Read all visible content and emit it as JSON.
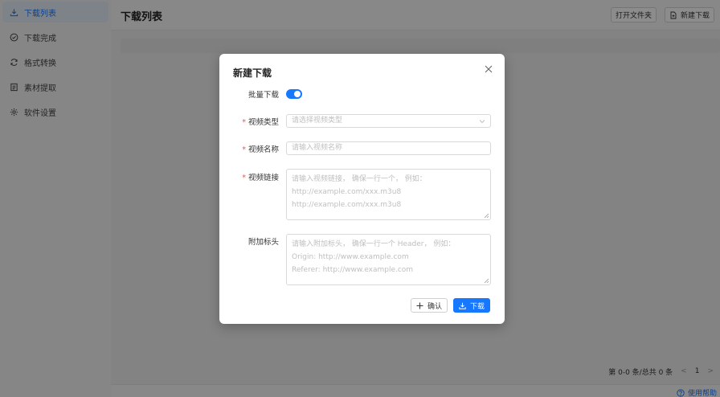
{
  "sidebar": {
    "items": [
      {
        "label": "下载列表",
        "icon": "download-icon",
        "active": true
      },
      {
        "label": "下载完成",
        "icon": "check-circle-icon",
        "active": false
      },
      {
        "label": "格式转换",
        "icon": "refresh-icon",
        "active": false
      },
      {
        "label": "素材提取",
        "icon": "document-icon",
        "active": false
      },
      {
        "label": "软件设置",
        "icon": "gear-icon",
        "active": false
      }
    ]
  },
  "header": {
    "title": "下载列表",
    "open_folder_label": "打开文件夹",
    "new_download_label": "新建下载"
  },
  "footer": {
    "summary": "第 0-0 条/总共 0 条",
    "page_prev": "<",
    "page_current": "1",
    "page_next": ">",
    "help_label": "使用帮助"
  },
  "modal": {
    "title": "新建下载",
    "batch_label": "批量下载",
    "batch_enabled": true,
    "video_type_label": "视频类型",
    "video_type_placeholder": "请选择视频类型",
    "video_name_label": "视频名称",
    "video_name_placeholder": "请输入视频名称",
    "video_link_label": "视频链接",
    "video_link_placeholder_lines": [
      "请输入视频链接， 确保一行一个， 例如：",
      "http://example.com/xxx.m3u8",
      "http://example.com/xxx.m3u8"
    ],
    "headers_label": "附加标头",
    "headers_placeholder_lines": [
      "请输入附加标头， 确保一行一个 Header， 例如：",
      "Origin: http://www.example.com",
      "Referer: http://www.example.com"
    ],
    "confirm_label": "确认",
    "download_label": "下载"
  },
  "colors": {
    "accent": "#1677ff",
    "required": "#ff4d4f"
  }
}
